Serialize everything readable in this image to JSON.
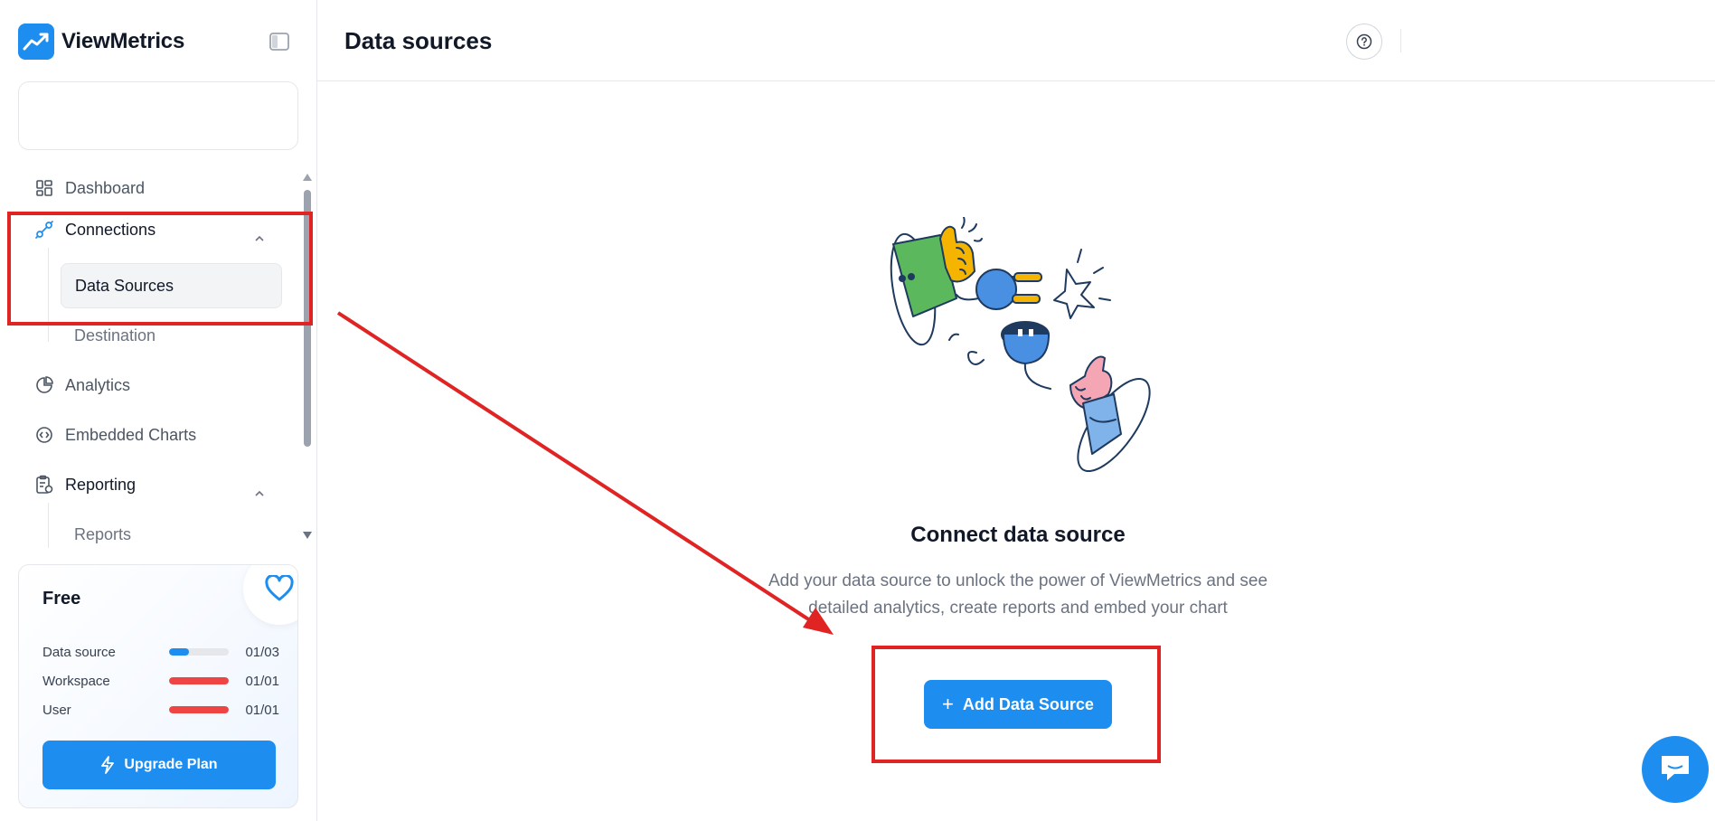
{
  "brand": {
    "name": "ViewMetrics",
    "accent": "#1d8ef0"
  },
  "header": {
    "title": "Data sources",
    "help_icon": "help-circle-icon"
  },
  "sidebar": {
    "items": [
      {
        "label": "Dashboard",
        "icon": "dashboard-grid-icon"
      },
      {
        "label": "Connections",
        "icon": "plug-connection-icon",
        "expanded": true,
        "children": [
          {
            "label": "Data Sources",
            "active": true
          },
          {
            "label": "Destination"
          }
        ]
      },
      {
        "label": "Analytics",
        "icon": "pie-chart-icon"
      },
      {
        "label": "Embedded Charts",
        "icon": "code-circle-icon"
      },
      {
        "label": "Reporting",
        "icon": "clipboard-report-icon",
        "expanded": true,
        "children": [
          {
            "label": "Reports"
          }
        ]
      }
    ]
  },
  "plan": {
    "title": "Free",
    "usage": [
      {
        "label": "Data source",
        "count": "01/03",
        "fraction": 0.33,
        "color": "#1d8ef0"
      },
      {
        "label": "Workspace",
        "count": "01/01",
        "fraction": 1.0,
        "color": "#ef4444"
      },
      {
        "label": "User",
        "count": "01/01",
        "fraction": 1.0,
        "color": "#ef4444"
      }
    ],
    "upgrade_label": "Upgrade Plan"
  },
  "empty_state": {
    "title": "Connect data source",
    "description": "Add your data source to unlock the power of ViewMetrics and see detailed analytics, create reports and embed your chart",
    "button_label": "Add Data Source"
  },
  "annotation_color": "#e02424"
}
